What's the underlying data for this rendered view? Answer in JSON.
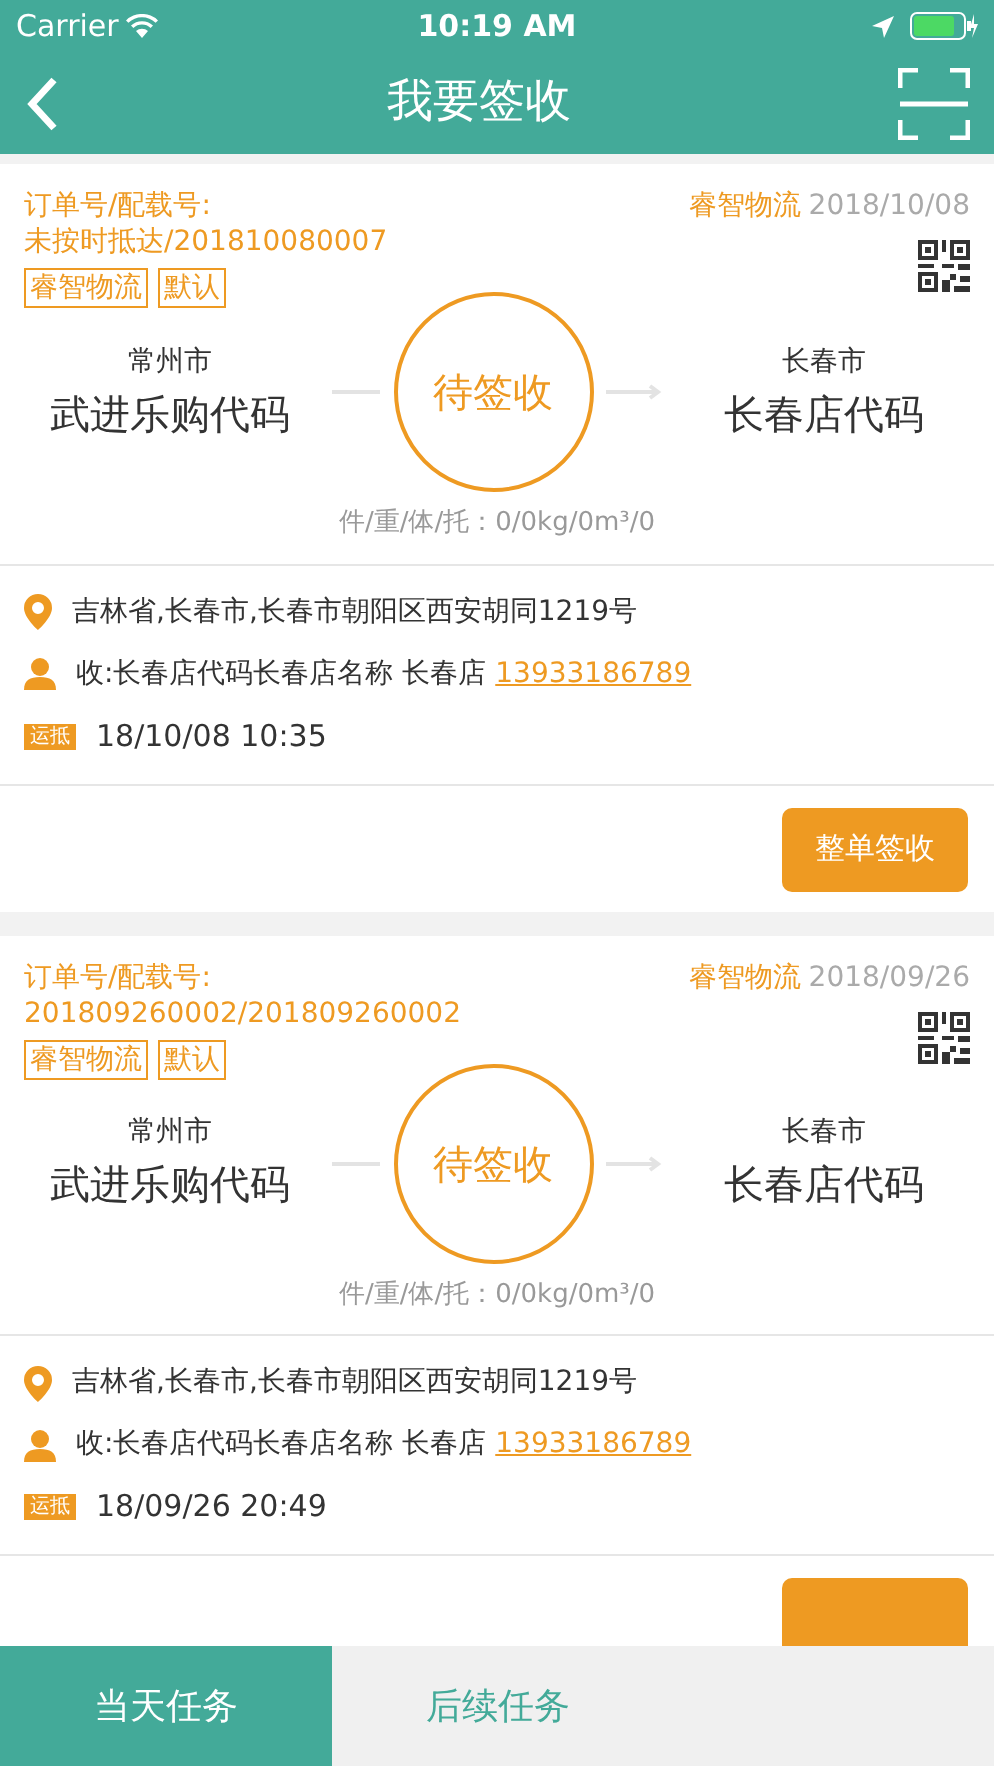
{
  "status_bar": {
    "carrier": "Carrier",
    "time": "10:19 AM"
  },
  "nav": {
    "title": "我要签收"
  },
  "orders": [
    {
      "order_label": "订单号/配载号:",
      "order_number": "未按时抵达/201810080007",
      "carrier_name": "睿智物流",
      "date": "2018/10/08",
      "tags": [
        "睿智物流",
        "默认"
      ],
      "from_city": "常州市",
      "from_site": "武进乐购代码",
      "status": "待签收",
      "to_city": "长春市",
      "to_site": "长春店代码",
      "stats": "件/重/体/托：0/0kg/0m³/0",
      "address": "吉林省,长春市,长春市朝阳区西安胡同1219号",
      "receiver": "收:长春店代码长春店名称 长春店",
      "phone": "13933186789",
      "time_badge": "运抵",
      "time": "18/10/08 10:35",
      "button": "整单签收"
    },
    {
      "order_label": "订单号/配载号:",
      "order_number": "201809260002/201809260002",
      "carrier_name": "睿智物流",
      "date": "2018/09/26",
      "tags": [
        "睿智物流",
        "默认"
      ],
      "from_city": "常州市",
      "from_site": "武进乐购代码",
      "status": "待签收",
      "to_city": "长春市",
      "to_site": "长春店代码",
      "stats": "件/重/体/托：0/0kg/0m³/0",
      "address": "吉林省,长春市,长春市朝阳区西安胡同1219号",
      "receiver": "收:长春店代码长春店名称 长春店",
      "phone": "13933186789",
      "time_badge": "运抵",
      "time": "18/09/26 20:49"
    }
  ],
  "tabs": [
    {
      "label": "当天任务",
      "selected": true
    },
    {
      "label": "后续任务",
      "selected": false
    }
  ]
}
